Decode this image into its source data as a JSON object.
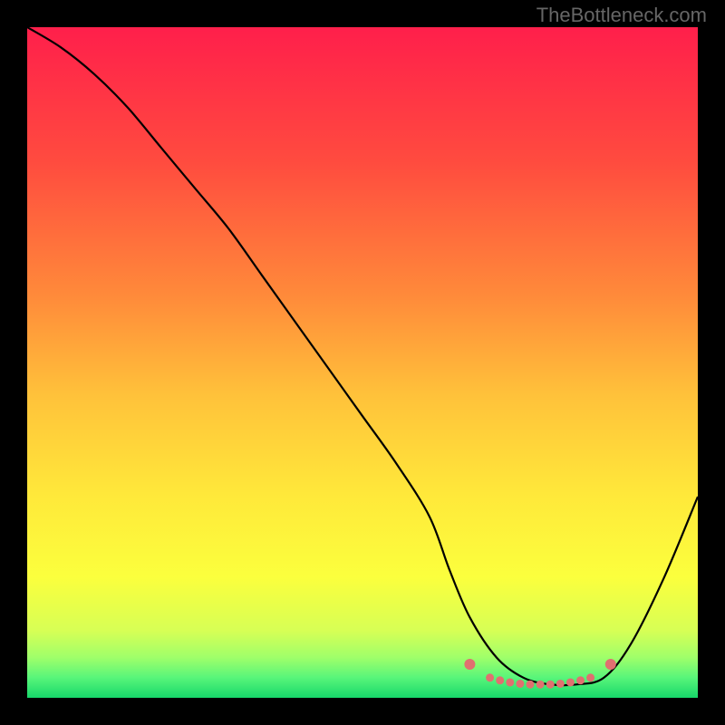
{
  "watermark": "TheBottleneck.com",
  "chart_data": {
    "type": "line",
    "title": "",
    "xlabel": "",
    "ylabel": "",
    "xlim": [
      0,
      100
    ],
    "ylim": [
      0,
      100
    ],
    "series": [
      {
        "name": "bottleneck-curve",
        "x": [
          0,
          5,
          10,
          15,
          20,
          25,
          30,
          35,
          40,
          45,
          50,
          55,
          60,
          63,
          66,
          70,
          74,
          78,
          82,
          86,
          90,
          95,
          100
        ],
        "y": [
          100,
          97,
          93,
          88,
          82,
          76,
          70,
          63,
          56,
          49,
          42,
          35,
          27,
          19,
          12,
          6,
          3,
          2,
          2,
          3,
          8,
          18,
          30
        ]
      }
    ],
    "optimal_markers": {
      "name": "optimal-range-dots",
      "x": [
        66,
        69,
        70.5,
        72,
        73.5,
        75,
        76.5,
        78,
        79.5,
        81,
        82.5,
        84,
        87
      ],
      "y": [
        5,
        3,
        2.6,
        2.3,
        2.1,
        2,
        2,
        2,
        2.1,
        2.3,
        2.6,
        3,
        5
      ]
    },
    "background_gradient": {
      "direction": "vertical",
      "stops": [
        {
          "pos": 0.0,
          "color": "#ff1f4b"
        },
        {
          "pos": 0.2,
          "color": "#ff4b3f"
        },
        {
          "pos": 0.4,
          "color": "#ff8a3a"
        },
        {
          "pos": 0.55,
          "color": "#ffc23a"
        },
        {
          "pos": 0.7,
          "color": "#ffe93a"
        },
        {
          "pos": 0.82,
          "color": "#fbff3d"
        },
        {
          "pos": 0.9,
          "color": "#d7ff55"
        },
        {
          "pos": 0.94,
          "color": "#9fff6a"
        },
        {
          "pos": 0.97,
          "color": "#58f57a"
        },
        {
          "pos": 1.0,
          "color": "#17d86a"
        }
      ]
    },
    "curve_color": "#000000",
    "marker_color": "#e07070"
  }
}
